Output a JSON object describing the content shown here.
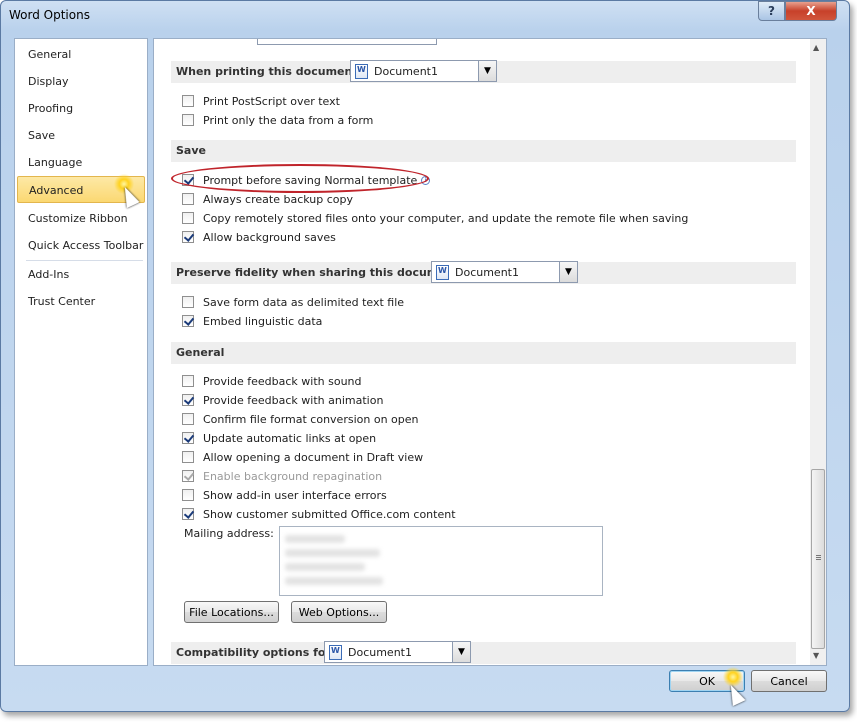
{
  "window": {
    "title": "Word Options",
    "help_glyph": "?",
    "close_glyph": "X"
  },
  "nav": {
    "items": [
      "General",
      "Display",
      "Proofing",
      "Save",
      "Language",
      "Advanced",
      "Customize Ribbon",
      "Quick Access Toolbar",
      "Add-Ins",
      "Trust Center"
    ],
    "selected": "Advanced"
  },
  "printing": {
    "header": "When printing this document:",
    "document": "Document1",
    "options": [
      {
        "label": "Print PostScript over text",
        "checked": false
      },
      {
        "label": "Print only the data from a form",
        "checked": false
      }
    ]
  },
  "save": {
    "header": "Save",
    "options": [
      {
        "label": "Prompt before saving Normal template",
        "checked": true
      },
      {
        "label": "Always create backup copy",
        "checked": false
      },
      {
        "label": "Copy remotely stored files onto your computer, and update the remote file when saving",
        "checked": false
      },
      {
        "label": "Allow background saves",
        "checked": true
      }
    ]
  },
  "fidelity": {
    "header": "Preserve fidelity when sharing this document:",
    "document": "Document1",
    "options": [
      {
        "label": "Save form data as delimited text file",
        "checked": false
      },
      {
        "label": "Embed linguistic data",
        "checked": true
      }
    ]
  },
  "general": {
    "header": "General",
    "options": [
      {
        "label": "Provide feedback with sound",
        "checked": false
      },
      {
        "label": "Provide feedback with animation",
        "checked": true
      },
      {
        "label": "Confirm file format conversion on open",
        "checked": false
      },
      {
        "label": "Update automatic links at open",
        "checked": true
      },
      {
        "label": "Allow opening a document in Draft view",
        "checked": false
      },
      {
        "label": "Enable background repagination",
        "checked": true,
        "disabled": true
      },
      {
        "label": "Show add-in user interface errors",
        "checked": false
      },
      {
        "label": "Show customer submitted Office.com content",
        "checked": true
      }
    ],
    "mailing_label": "Mailing address:",
    "file_locations": "File Locations...",
    "web_options": "Web Options..."
  },
  "compat": {
    "header": "Compatibility options for:",
    "document": "Document1"
  },
  "footer": {
    "ok": "OK",
    "cancel": "Cancel"
  },
  "dropdown_arrow": "▼",
  "scroll_up": "▲",
  "scroll_down": "▼"
}
